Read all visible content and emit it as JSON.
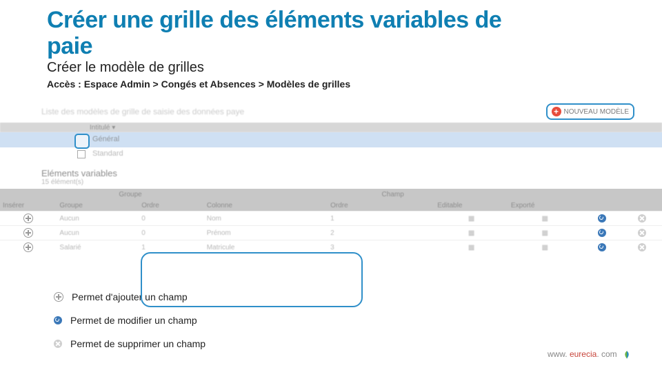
{
  "title_line1": "Créer une grille des éléments variables de",
  "title_line2": "paie",
  "subtitle": "Créer le modèle de grilles",
  "access_path": "Accès : Espace Admin > Congés et Absences > Modèles de grilles",
  "screenshot": {
    "list_title": "Liste des modèles de grille de saisie des données paye",
    "header_col": "Intitulé ▾",
    "new_button": "NOUVEAU MODÈLE",
    "row_selected": "Général",
    "row_standard": "Standard",
    "section_title": "Eléments variables",
    "section_count": "15 élément(s)",
    "group_header_left": "Groupe",
    "group_header_right": "Champ",
    "cols": {
      "insert": "Insérer",
      "group": "Groupe",
      "g_order": "Ordre",
      "g_col": "Colonne",
      "c_order": "Ordre",
      "editable": "Editable",
      "export": "Exporté"
    },
    "rows": [
      {
        "grp": "Aucun",
        "gord": "0",
        "gcol": "Nom",
        "cord": "1"
      },
      {
        "grp": "Aucun",
        "gord": "0",
        "gcol": "Prénom",
        "cord": "2"
      },
      {
        "grp": "Salarié",
        "gord": "1",
        "gcol": "Matricule",
        "cord": "3"
      }
    ]
  },
  "legend": {
    "add": "Permet d'ajouter un champ",
    "edit": "Permet de modifier un champ",
    "delete": "Permet de supprimer un champ"
  },
  "footer": {
    "prefix": "www. ",
    "brand": "eurecia",
    "suffix": ". com"
  }
}
